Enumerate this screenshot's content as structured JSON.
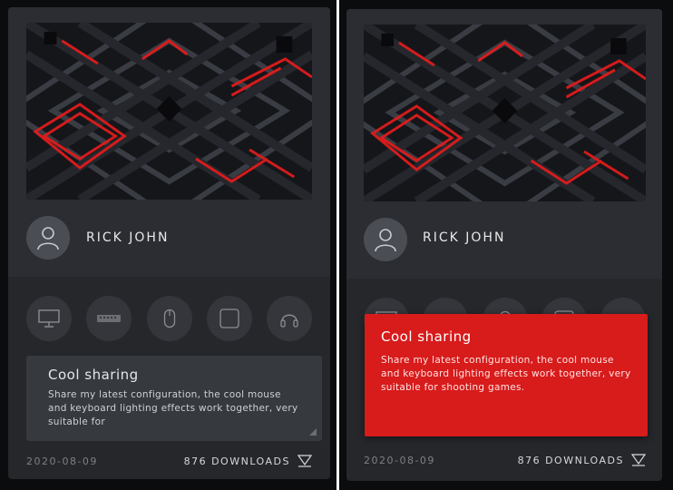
{
  "cards": [
    {
      "user": {
        "name": "RICK JOHN"
      },
      "gear_icons": [
        "monitor-icon",
        "keyboard-icon",
        "mouse-icon",
        "mousepad-icon",
        "headset-icon"
      ],
      "description": {
        "title": "Cool sharing",
        "text": "Share my latest configuration, the cool mouse and keyboard lighting effects work together, very suitable for"
      },
      "footer": {
        "date": "2020-08-09",
        "downloads": "876 DOWNLOADS"
      },
      "state": "default"
    },
    {
      "user": {
        "name": "RICK JOHN"
      },
      "gear_icons": [
        "monitor-icon",
        "keyboard-icon",
        "mouse-icon",
        "mousepad-icon",
        "headset-icon"
      ],
      "description": {
        "title": "Cool sharing",
        "text": "Share my latest configuration, the cool mouse and keyboard lighting effects work together, very suitable for shooting games."
      },
      "footer": {
        "date": "2020-08-09",
        "downloads": "876 DOWNLOADS"
      },
      "state": "hover-expanded"
    }
  ],
  "colors": {
    "accent": "#d81b1b",
    "card_bg": "#25272b",
    "card_top_bg": "#2b2d32",
    "text_muted": "#7d8085"
  }
}
